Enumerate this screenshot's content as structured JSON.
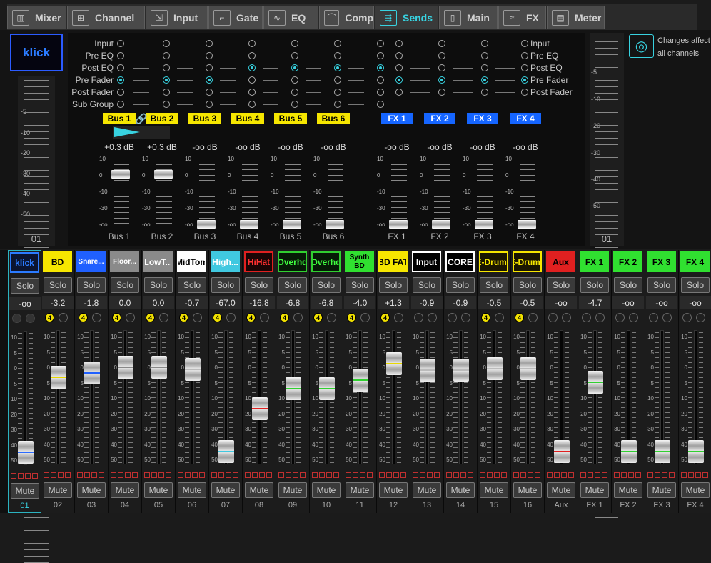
{
  "tabs": [
    {
      "label": "Mixer",
      "icon": "mixer-icon",
      "glyph": "▥",
      "active": false
    },
    {
      "label": "Channel",
      "icon": "channel-icon",
      "glyph": "⊞",
      "active": false
    },
    {
      "label": "Input",
      "icon": "input-icon",
      "glyph": "⇲",
      "active": false
    },
    {
      "label": "Gate",
      "icon": "gate-icon",
      "glyph": "⌐",
      "active": false
    },
    {
      "label": "EQ",
      "icon": "eq-icon",
      "glyph": "∿",
      "active": false
    },
    {
      "label": "Comp",
      "icon": "comp-icon",
      "glyph": "⌒",
      "active": false
    },
    {
      "label": "Sends",
      "icon": "sends-icon",
      "glyph": "⇶",
      "active": true
    },
    {
      "label": "Main",
      "icon": "main-icon",
      "glyph": "▯",
      "active": false
    },
    {
      "label": "FX",
      "icon": "fx-icon",
      "glyph": "≈",
      "active": false
    },
    {
      "label": "Meter",
      "icon": "meter-icon",
      "glyph": "▤",
      "active": false
    }
  ],
  "selected_channel": {
    "name": "klick",
    "number": "01"
  },
  "meter_scale": [
    "-5",
    "-10",
    "-20",
    "-30",
    "-40",
    "-50"
  ],
  "right_meter": {
    "number": "01"
  },
  "send_rows_left": [
    "Input",
    "Pre EQ",
    "Post EQ",
    "Pre Fader",
    "Post Fader",
    "Sub Group"
  ],
  "send_rows_right": [
    "Input",
    "Pre EQ",
    "Post EQ",
    "Pre Fader",
    "Post Fader"
  ],
  "mini_scale": [
    "10",
    "0",
    "-10",
    "-30",
    "-oo"
  ],
  "buses": [
    {
      "label": "Bus 1",
      "level": "+0.3 dB",
      "name": "Bus 1",
      "tap": 3,
      "fader_db": 0.3
    },
    {
      "label": "Bus 2",
      "level": "+0.3 dB",
      "name": "Bus 2",
      "tap": 3,
      "fader_db": 0.3
    },
    {
      "label": "Bus 3",
      "level": "-oo dB",
      "name": "Bus 3",
      "tap": 2,
      "fader_db": -100
    },
    {
      "label": "Bus 4",
      "level": "-oo dB",
      "name": "Bus 4",
      "tap": 2,
      "fader_db": -100
    },
    {
      "label": "Bus 5",
      "level": "-oo dB",
      "name": "Bus 5",
      "tap": 2,
      "fader_db": -100
    },
    {
      "label": "Bus 6",
      "level": "-oo dB",
      "name": "Bus 6",
      "tap": 2,
      "fader_db": -100
    }
  ],
  "fx_sends": [
    {
      "label": "FX 1",
      "level": "-oo dB",
      "name": "FX 1",
      "tap": 3,
      "fader_db": -100
    },
    {
      "label": "FX 2",
      "level": "-oo dB",
      "name": "FX 2",
      "tap": 3,
      "fader_db": -100
    },
    {
      "label": "FX 3",
      "level": "-oo dB",
      "name": "FX 3",
      "tap": 3,
      "fader_db": -100
    },
    {
      "label": "FX 4",
      "level": "-oo dB",
      "name": "FX 4",
      "tap": 3,
      "fader_db": -100
    }
  ],
  "changes_note": {
    "line1": "Changes affect",
    "line2": "all channels"
  },
  "strip_labels": {
    "solo": "Solo",
    "mute": "Mute",
    "four": "4"
  },
  "fader_scale": [
    "10",
    "5",
    "0",
    "5",
    "10",
    "20",
    "30",
    "40",
    "50",
    "60"
  ],
  "channels": [
    {
      "name": "klick",
      "gain": "-oo",
      "num": "01",
      "bg": "#0b1430",
      "fg": "#2b7bff",
      "border": "#2b7bff",
      "cap": "#2b6bff",
      "fader_db": -60,
      "four": false,
      "dark": true
    },
    {
      "name": "BD",
      "gain": "-3.2",
      "num": "02",
      "bg": "#f6e600",
      "fg": "#000",
      "border": "#f6e600",
      "cap": "#e8d800",
      "fader_db": -3.2,
      "four": true
    },
    {
      "name": "Snare...",
      "gain": "-1.8",
      "num": "03",
      "bg": "#2060ff",
      "fg": "#fff",
      "border": "#2060ff",
      "cap": "#2060ff",
      "fader_db": -1.8,
      "four": true
    },
    {
      "name": "Floor...",
      "gain": "0.0",
      "num": "04",
      "bg": "#8a8a8a",
      "fg": "#fff",
      "border": "#8a8a8a",
      "cap": "#888888",
      "fader_db": 0,
      "four": true
    },
    {
      "name": "LowT...",
      "gain": "0.0",
      "num": "05",
      "bg": "#8a8a8a",
      "fg": "#fff",
      "border": "#8a8a8a",
      "cap": "#888888",
      "fader_db": 0,
      "four": true
    },
    {
      "name": "MidTom",
      "gain": "-0.7",
      "num": "06",
      "bg": "#ffffff",
      "fg": "#000",
      "border": "#ffffff",
      "cap": "#bbbbbb",
      "fader_db": -0.7,
      "four": true
    },
    {
      "name": "High...",
      "gain": "-67.0",
      "num": "07",
      "bg": "#40c8e0",
      "fg": "#fff",
      "border": "#40c8e0",
      "cap": "#40c8e0",
      "fader_db": -67,
      "four": true
    },
    {
      "name": "HiHat",
      "gain": "-16.8",
      "num": "08",
      "bg": "#1a0505",
      "fg": "#ff3030",
      "border": "#e02020",
      "cap": "#e02020",
      "fader_db": -16.8,
      "four": true
    },
    {
      "name": "Overhd",
      "gain": "-6.8",
      "num": "09",
      "bg": "#061a06",
      "fg": "#40ff40",
      "border": "#30d030",
      "cap": "#30d030",
      "fader_db": -6.8,
      "four": true
    },
    {
      "name": "Overhd",
      "gain": "-6.8",
      "num": "10",
      "bg": "#061a06",
      "fg": "#40ff40",
      "border": "#30d030",
      "cap": "#30d030",
      "fader_db": -6.8,
      "four": true
    },
    {
      "name": "Synth BD",
      "gain": "-4.0",
      "num": "11",
      "bg": "#30e030",
      "fg": "#000",
      "border": "#30e030",
      "cap": "#30d030",
      "fader_db": -4,
      "four": true
    },
    {
      "name": "BD FAT",
      "gain": "+1.3",
      "num": "12",
      "bg": "#f6e600",
      "fg": "#000",
      "border": "#f6e600",
      "cap": "#e8d800",
      "fader_db": 1.3,
      "four": true
    },
    {
      "name": "Input",
      "gain": "-0.9",
      "num": "13",
      "bg": "#000000",
      "fg": "#fff",
      "border": "#ffffff",
      "cap": "#bbbbbb",
      "fader_db": -0.9,
      "four": false
    },
    {
      "name": "CORE",
      "gain": "-0.9",
      "num": "14",
      "bg": "#000000",
      "fg": "#fff",
      "border": "#ffffff",
      "cap": "#bbbbbb",
      "fader_db": -0.9,
      "four": false
    },
    {
      "name": "E-Drums",
      "gain": "-0.5",
      "num": "15",
      "bg": "#1a1600",
      "fg": "#f6e600",
      "border": "#f6e600",
      "cap": "#bbbbbb",
      "fader_db": -0.5,
      "four": true
    },
    {
      "name": "E-Drums",
      "gain": "-0.5",
      "num": "16",
      "bg": "#1a1600",
      "fg": "#f6e600",
      "border": "#f6e600",
      "cap": "#bbbbbb",
      "fader_db": -0.5,
      "four": true
    },
    {
      "name": "Aux",
      "gain": "-oo",
      "num": "Aux",
      "bg": "#e02020",
      "fg": "#000",
      "border": "#e02020",
      "cap": "#e02020",
      "fader_db": -60,
      "four": false
    },
    {
      "name": "FX 1",
      "gain": "-4.7",
      "num": "FX 1",
      "bg": "#30e030",
      "fg": "#000",
      "border": "#30e030",
      "cap": "#30d030",
      "fader_db": -4.7,
      "four": false
    },
    {
      "name": "FX 2",
      "gain": "-oo",
      "num": "FX 2",
      "bg": "#30e030",
      "fg": "#000",
      "border": "#30e030",
      "cap": "#30d030",
      "fader_db": -60,
      "four": false
    },
    {
      "name": "FX 3",
      "gain": "-oo",
      "num": "FX 3",
      "bg": "#30e030",
      "fg": "#000",
      "border": "#30e030",
      "cap": "#30d030",
      "fader_db": -60,
      "four": false
    },
    {
      "name": "FX 4",
      "gain": "-oo",
      "num": "FX 4",
      "bg": "#30e030",
      "fg": "#000",
      "border": "#30e030",
      "cap": "#30d030",
      "fader_db": -60,
      "four": false
    }
  ]
}
